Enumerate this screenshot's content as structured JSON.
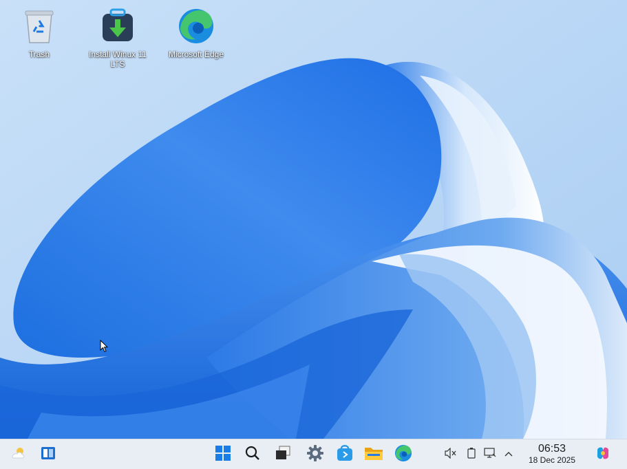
{
  "desktop": {
    "icons": [
      {
        "label": "Trash",
        "icon": "recycle-bin-icon"
      },
      {
        "label": "Install Winux 11 LTS",
        "icon": "installer-icon"
      },
      {
        "label": "Microsoft Edge",
        "icon": "edge-icon"
      }
    ]
  },
  "taskbar": {
    "left": [
      {
        "icon": "weather-icon"
      },
      {
        "icon": "widgets-icon"
      }
    ],
    "center": [
      {
        "icon": "start-icon"
      },
      {
        "icon": "search-icon"
      },
      {
        "icon": "task-view-icon"
      },
      {
        "icon": "settings-icon"
      },
      {
        "icon": "store-icon"
      },
      {
        "icon": "file-explorer-icon"
      },
      {
        "icon": "edge-icon"
      }
    ],
    "tray": [
      {
        "icon": "volume-muted-icon"
      },
      {
        "icon": "battery-icon"
      },
      {
        "icon": "network-icon"
      },
      {
        "icon": "chevron-up-icon"
      }
    ],
    "clock": {
      "time": "06:53",
      "date": "18 Dec 2025"
    },
    "copilot": {
      "icon": "copilot-icon"
    }
  },
  "colors": {
    "accent": "#2f7be0",
    "wallpaper_bg": "#b9d6f5",
    "taskbar_bg": "#e9eef5"
  }
}
